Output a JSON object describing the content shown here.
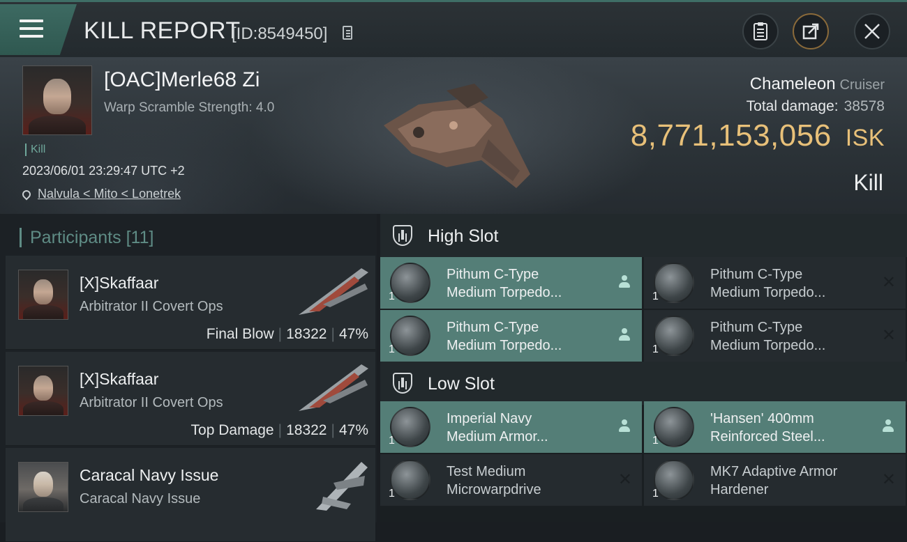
{
  "header": {
    "title": "KILL REPORT",
    "report_id": "[ID:8549450]"
  },
  "victim": {
    "name": "[OAC]Merle68 Zi",
    "warp_scramble": "Warp Scramble Strength: 4.0",
    "tag": "Kill",
    "time": "2023/06/01 23:29:47 UTC +2",
    "location": "Nalvula < Mito < Lonetrek"
  },
  "ship": {
    "name": "Chameleon",
    "class": "Cruiser",
    "total_damage_label": "Total damage:",
    "total_damage": "38578",
    "isk_value": "8,771,153,056",
    "isk_unit": "ISK",
    "result": "Kill"
  },
  "participants": {
    "label": "Participants",
    "count": "[11]",
    "items": [
      {
        "name": "[X]Skaffaar",
        "ship": "Arbitrator II Covert Ops",
        "role": "Final Blow",
        "damage": "18322",
        "percent": "47%"
      },
      {
        "name": "[X]Skaffaar",
        "ship": "Arbitrator II Covert Ops",
        "role": "Top Damage",
        "damage": "18322",
        "percent": "47%"
      },
      {
        "name": "Caracal Navy Issue",
        "ship": "Caracal Navy Issue",
        "role": "",
        "damage": "",
        "percent": ""
      }
    ]
  },
  "high_slot": {
    "label": "High Slot",
    "items": [
      {
        "line1": "Pithum C-Type",
        "line2": "Medium Torpedo...",
        "qty": "1",
        "status": "dropped"
      },
      {
        "line1": "Pithum C-Type",
        "line2": "Medium Torpedo...",
        "qty": "1",
        "status": "destroyed"
      },
      {
        "line1": "Pithum C-Type",
        "line2": "Medium Torpedo...",
        "qty": "1",
        "status": "dropped"
      },
      {
        "line1": "Pithum C-Type",
        "line2": "Medium Torpedo...",
        "qty": "1",
        "status": "destroyed"
      }
    ]
  },
  "low_slot": {
    "label": "Low Slot",
    "items": [
      {
        "line1": "Imperial Navy",
        "line2": "Medium Armor...",
        "qty": "1",
        "status": "dropped"
      },
      {
        "line1": "'Hansen' 400mm",
        "line2": "Reinforced Steel...",
        "qty": "1",
        "status": "dropped"
      },
      {
        "line1": "Test Medium",
        "line2": "Microwarpdrive",
        "qty": "1",
        "status": "destroyed"
      },
      {
        "line1": "MK7 Adaptive Armor",
        "line2": "Hardener",
        "qty": "1",
        "status": "destroyed"
      }
    ]
  },
  "icons": {
    "menu": "hamburger-icon",
    "copy": "copy-icon",
    "clipboard": "clipboard-icon",
    "share": "share-icon",
    "close": "close-icon",
    "location": "location-pin-icon",
    "slot": "shield-slot-icon",
    "dropped": "person-icon",
    "destroyed": "x-icon"
  },
  "colors": {
    "accent_teal": "#547e77",
    "isk_gold": "#e8c079",
    "participants_label": "#5f8c85"
  }
}
